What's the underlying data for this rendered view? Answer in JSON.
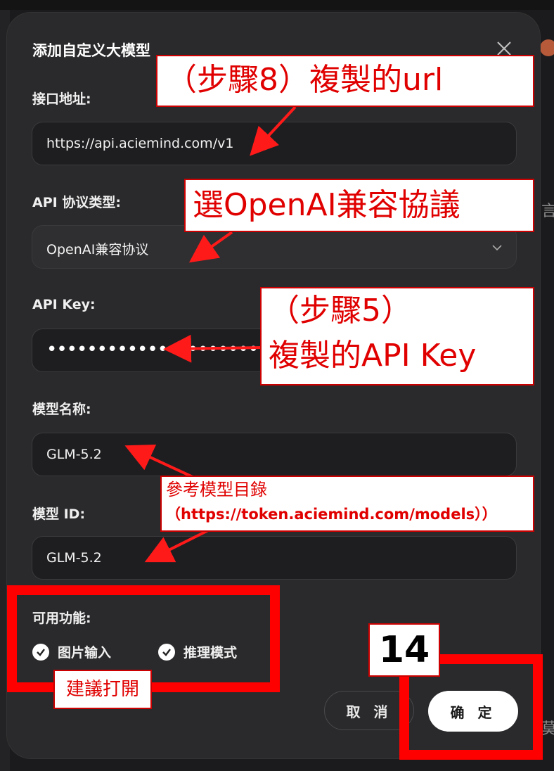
{
  "dialog": {
    "title": "添加自定义大模型",
    "close_icon": "close-icon",
    "fields": {
      "endpoint": {
        "label": "接口地址:",
        "value": "https://api.aciemind.com/v1"
      },
      "protocol": {
        "label": "API 协议类型:",
        "value": "OpenAI兼容协议"
      },
      "api_key": {
        "label": "API Key:",
        "value": "•••••••••••••••••••••••••••••••••••••••"
      },
      "model_name": {
        "label": "模型名称:",
        "value": "GLM-5.2"
      },
      "model_id": {
        "label": "模型 ID:",
        "value": "GLM-5.2"
      }
    },
    "features": {
      "label": "可用功能:",
      "options": [
        {
          "label": "图片输入",
          "checked": true
        },
        {
          "label": "推理模式",
          "checked": true
        }
      ]
    },
    "buttons": {
      "cancel": "取 消",
      "ok": "确 定"
    }
  },
  "annotations": {
    "step8": "（步驟8）複製的url",
    "select_openai": "選OpenAI兼容協議",
    "step5_line1": "（步驟5）",
    "step5_line2": "複製的API Key",
    "model_ref_line1": "參考模型目錄",
    "model_ref_line2": "（https://token.aciemind.com/models））",
    "recommend_on": "建議打開",
    "step_number": "14"
  },
  "background": {
    "frag1": "言",
    "frag2": "莫"
  },
  "colors": {
    "annotation_red": "#ff0000",
    "dialog_bg": "#2a2a2c",
    "field_bg": "#1e1e20"
  }
}
